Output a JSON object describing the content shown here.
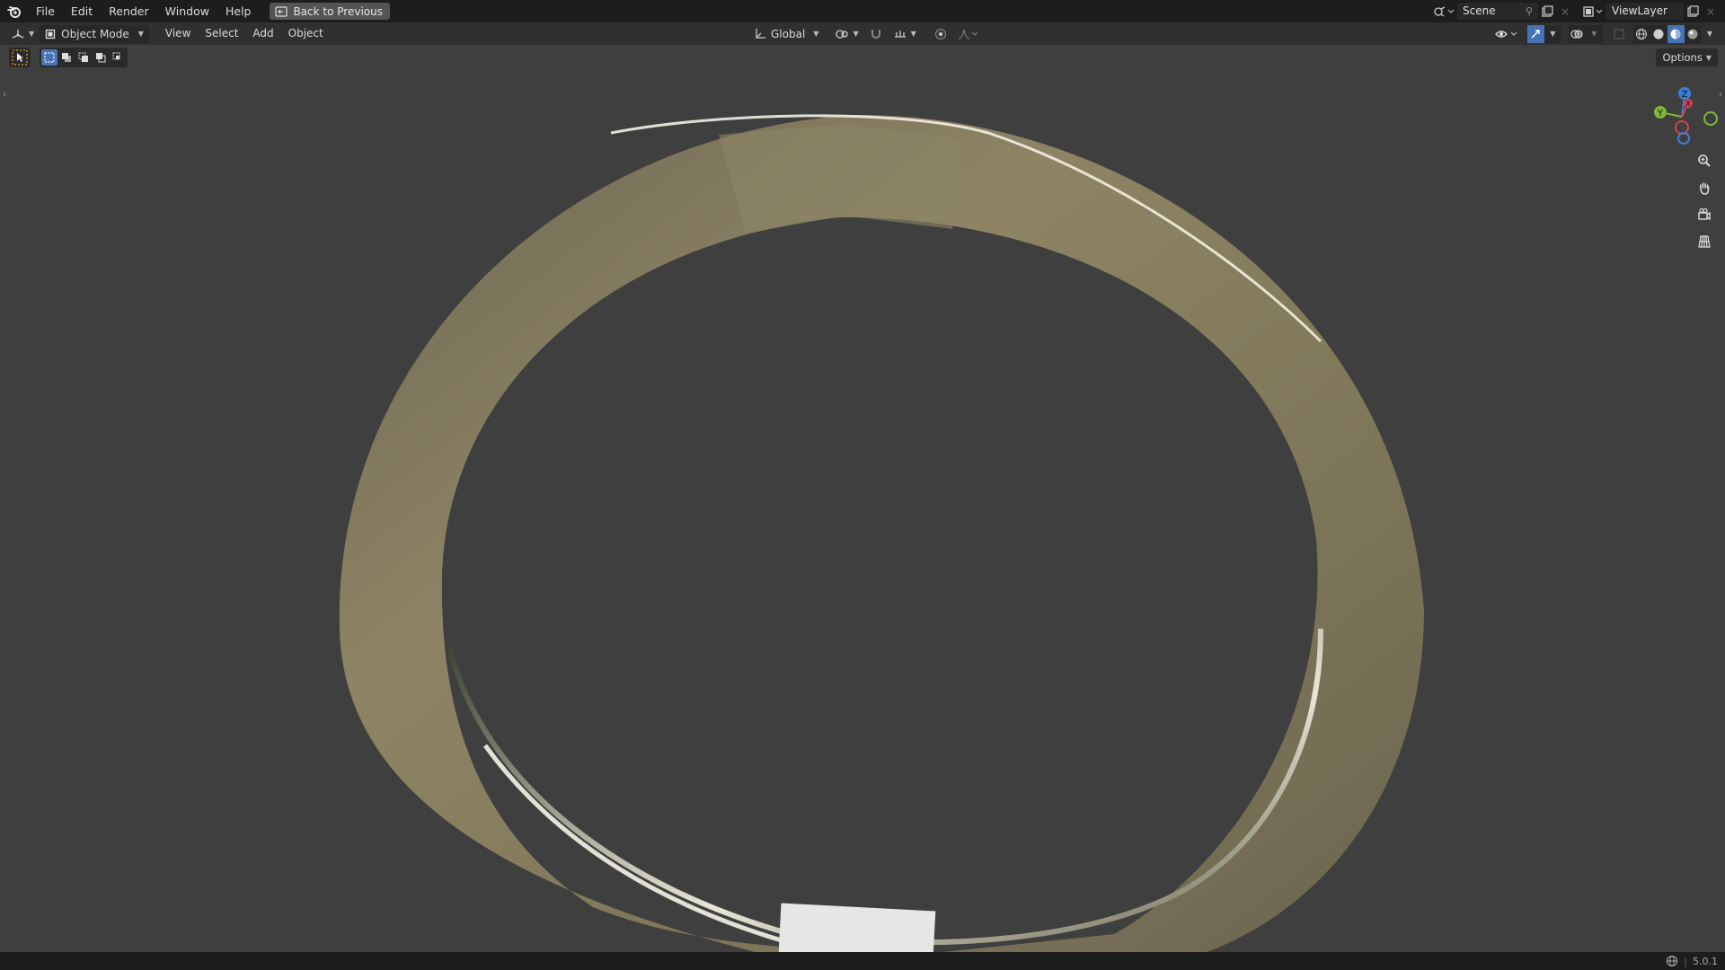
{
  "topbar": {
    "menu": [
      "File",
      "Edit",
      "Render",
      "Window",
      "Help"
    ],
    "back_button": "Back to Previous",
    "scene_name": "Scene",
    "view_layer_name": "ViewLayer"
  },
  "header": {
    "mode": "Object Mode",
    "menus": [
      "View",
      "Select",
      "Add",
      "Object"
    ],
    "transform_orientation": "Global"
  },
  "viewport": {
    "options_label": "Options",
    "gizmo_axes": [
      "Z",
      "Y",
      "X"
    ],
    "object_color": "#8e8465",
    "background_color": "#3f3f3f"
  },
  "status": {
    "version": "5.0.1"
  },
  "colors": {
    "accent": "#4772b3",
    "axis_x": "#d6434f",
    "axis_y": "#7fb73a",
    "axis_z": "#3b7fd9"
  }
}
